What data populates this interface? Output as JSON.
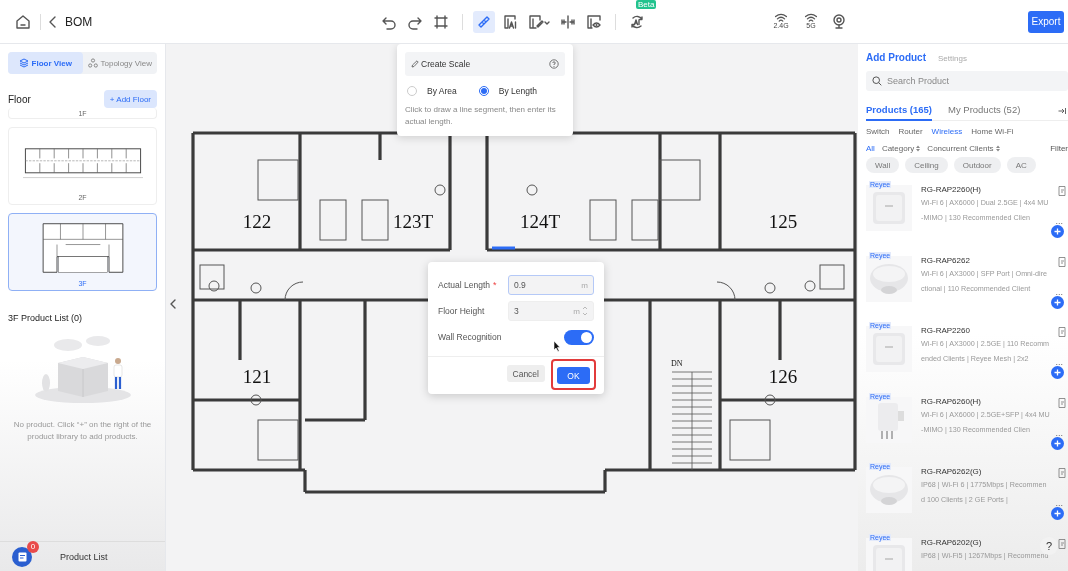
{
  "header": {
    "title": "BOM",
    "export_button": "Export"
  },
  "toolbar": {
    "groups": [
      [
        {
          "kind": "undo",
          "selected": false
        },
        {
          "kind": "redo",
          "selected": false
        },
        {
          "kind": "frame",
          "selected": false
        }
      ],
      [
        {
          "kind": "ruler",
          "selected": true
        },
        {
          "kind": "ai-text",
          "selected": false
        },
        {
          "kind": "edit",
          "selected": false
        },
        {
          "kind": "split",
          "selected": false
        },
        {
          "kind": "layer-eye",
          "selected": false
        }
      ],
      [
        {
          "kind": "ai-scan",
          "selected": false,
          "badge": "Beta"
        }
      ]
    ],
    "signals": [
      {
        "kind": "wifi",
        "label": "2.4G"
      },
      {
        "kind": "wifi",
        "label": "5G"
      },
      {
        "kind": "pin"
      }
    ]
  },
  "left_panel": {
    "view_tabs": [
      {
        "label": "Floor View",
        "kind": "floor",
        "selected": true
      },
      {
        "label": "Topology View",
        "kind": "topology",
        "selected": false
      }
    ],
    "floor_heading": "Floor",
    "add_floor_button": "+ Add Floor",
    "floors": [
      {
        "label": "1F",
        "kind": "stub",
        "selected": false
      },
      {
        "label": "2F",
        "kind": "long",
        "selected": false
      },
      {
        "label": "3F",
        "kind": "wide",
        "selected": true
      }
    ],
    "product_list_heading": "3F Product List (0)",
    "empty_text": "No product. Click “+” on the right of the product library to add products.",
    "footer": {
      "label": "Product List",
      "badge": "0"
    }
  },
  "canvas": {
    "rooms": [
      "122",
      "123T",
      "124T",
      "125",
      "121",
      "126"
    ],
    "stair_label": "DN",
    "scale_popup": {
      "title": "Create Scale",
      "options": [
        {
          "label": "By Area",
          "selected": false
        },
        {
          "label": "By Length",
          "selected": true
        }
      ],
      "hint": "Click to draw a line segment, then enter its actual length."
    },
    "dialog": {
      "fields": [
        {
          "label": "Actual Length",
          "required_mark": "*",
          "value": "0.9",
          "unit": "m",
          "kind": "text",
          "focused": true
        },
        {
          "label": "Floor Height",
          "value": "3",
          "unit": "m",
          "kind": "spinner",
          "focused": false
        }
      ],
      "toggle": {
        "label": "Wall Recognition",
        "on": true
      },
      "cancel_button": "Cancel",
      "ok_button": {
        "label": "OK",
        "highlighted": true
      }
    }
  },
  "right_panel": {
    "tabs": [
      {
        "label": "Add Product",
        "selected": true
      },
      {
        "label": "Settings",
        "selected": false
      }
    ],
    "search": {
      "placeholder": "Search Product"
    },
    "product_tabs": [
      {
        "label": "Products (165)",
        "selected": true
      },
      {
        "label": "My Products (52)",
        "selected": false
      }
    ],
    "categories": [
      {
        "label": "Switch",
        "selected": false
      },
      {
        "label": "Router",
        "selected": false
      },
      {
        "label": "Wireless",
        "selected": true
      },
      {
        "label": "Home Wi-Fi",
        "selected": false
      }
    ],
    "filters": {
      "all": "All",
      "sorts": [
        "Category",
        "Concurrent Clients"
      ],
      "filter": "Filter"
    },
    "chips": [
      "Wall",
      "Ceiling",
      "Outdoor",
      "AC"
    ],
    "products": [
      {
        "brand": "Reyee",
        "name": "RG-RAP2260(H)",
        "lines": [
          "Wi-Fi 6 | AX6000 | Dual 2.5GE | 4x4 MU",
          "-MIMO | 130 Recommended Clien"
        ],
        "more": "..."
      },
      {
        "brand": "Reyee",
        "name": "RG-RAP6262",
        "lines": [
          "Wi-Fi 6 | AX3000 | SFP Port | Omni-dire",
          "ctional | 110 Recommended Client"
        ],
        "more": "..."
      },
      {
        "brand": "Reyee",
        "name": "RG-RAP2260",
        "lines": [
          "Wi-Fi 6 | AX3000 | 2.5GE | 110 Recomm",
          "ended Clients | Reyee Mesh | 2x2"
        ],
        "more": "..."
      },
      {
        "brand": "Reyee",
        "name": "RG-RAP6260(H)",
        "lines": [
          "Wi-Fi 6 | AX6000 | 2.5GE+SFP | 4x4 MU",
          "-MIMO | 130 Recommended Clien"
        ],
        "more": "..."
      },
      {
        "brand": "Reyee",
        "name": "RG-RAP6262(G)",
        "lines": [
          "IP68 | Wi-Fi 6 | 1775Mbps | Recommen",
          "d 100 Clients | 2 GE Ports |"
        ],
        "more": "..."
      },
      {
        "brand": "Reyee",
        "name": "RG-RAP6202(G)",
        "lines": [
          "IP68 | Wi-Fi5 | 1267Mbps | Recommend"
        ]
      }
    ],
    "help_button": "?"
  }
}
